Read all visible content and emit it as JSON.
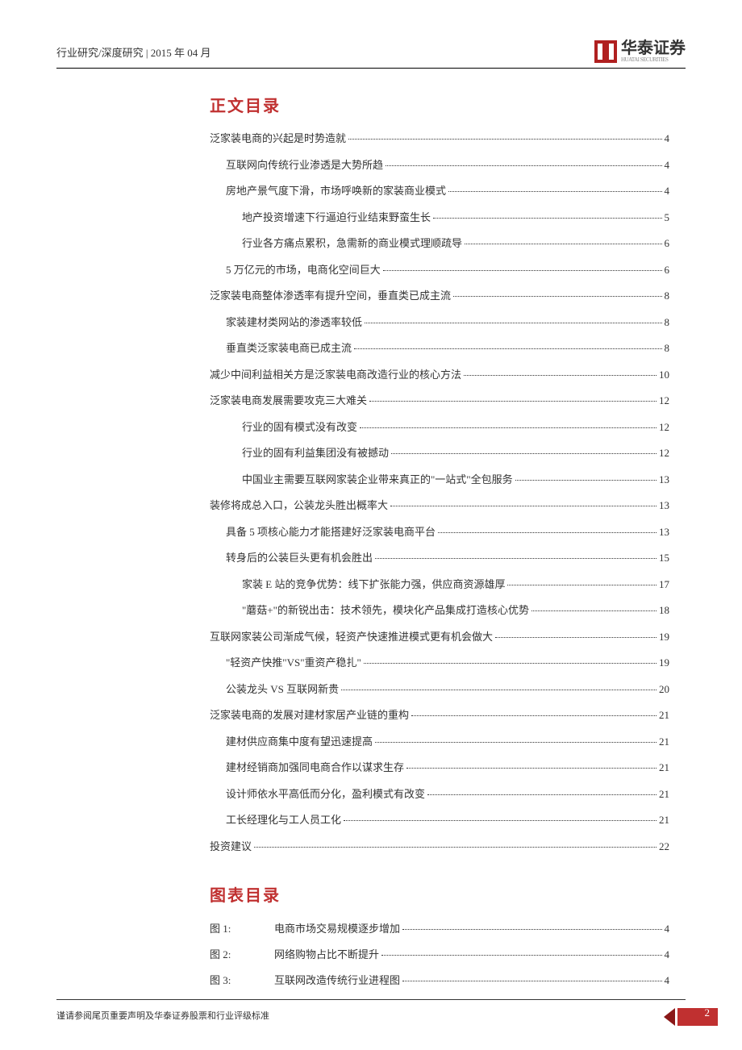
{
  "header": {
    "breadcrumb": "行业研究/深度研究 | 2015 年 04 月",
    "logo_name": "华泰证券",
    "logo_sub": "HUATAI SECURITIES"
  },
  "sections": {
    "toc_title": "正文目录",
    "fig_title": "图表目录"
  },
  "toc": [
    {
      "level": 1,
      "text": "泛家装电商的兴起是时势造就",
      "page": "4"
    },
    {
      "level": 2,
      "text": "互联网向传统行业渗透是大势所趋",
      "page": "4"
    },
    {
      "level": 2,
      "text": "房地产景气度下滑，市场呼唤新的家装商业模式",
      "page": "4"
    },
    {
      "level": 3,
      "text": "地产投资增速下行逼迫行业结束野蛮生长",
      "page": "5"
    },
    {
      "level": 3,
      "text": "行业各方痛点累积，急需新的商业模式理顺疏导",
      "page": "6"
    },
    {
      "level": 2,
      "text": "5 万亿元的市场，电商化空间巨大",
      "page": "6"
    },
    {
      "level": 1,
      "text": "泛家装电商整体渗透率有提升空间，垂直类已成主流",
      "page": "8"
    },
    {
      "level": 2,
      "text": "家装建材类网站的渗透率较低",
      "page": "8"
    },
    {
      "level": 2,
      "text": "垂直类泛家装电商已成主流",
      "page": "8"
    },
    {
      "level": 1,
      "text": "减少中间利益相关方是泛家装电商改造行业的核心方法",
      "page": "10"
    },
    {
      "level": 1,
      "text": "泛家装电商发展需要攻克三大难关",
      "page": "12"
    },
    {
      "level": 3,
      "text": "行业的固有模式没有改变",
      "page": "12"
    },
    {
      "level": 3,
      "text": "行业的固有利益集团没有被撼动",
      "page": "12"
    },
    {
      "level": 3,
      "text": "中国业主需要互联网家装企业带来真正的\"一站式\"全包服务",
      "page": "13"
    },
    {
      "level": 1,
      "text": "装修将成总入口，公装龙头胜出概率大",
      "page": "13"
    },
    {
      "level": 2,
      "text": "具备 5 项核心能力才能搭建好泛家装电商平台",
      "page": "13"
    },
    {
      "level": 2,
      "text": "转身后的公装巨头更有机会胜出",
      "page": "15"
    },
    {
      "level": 3,
      "text": "家装 E 站的竞争优势：线下扩张能力强，供应商资源雄厚",
      "page": "17"
    },
    {
      "level": 3,
      "text": "\"蘑菇+\"的新锐出击：技术领先，模块化产品集成打造核心优势",
      "page": "18"
    },
    {
      "level": 1,
      "text": "互联网家装公司渐成气候，轻资产快速推进模式更有机会做大",
      "page": "19"
    },
    {
      "level": 2,
      "text": "\"轻资产快推\"VS\"重资产稳扎\"",
      "page": "19"
    },
    {
      "level": 2,
      "text": "公装龙头 VS 互联网新贵",
      "page": "20"
    },
    {
      "level": 1,
      "text": "泛家装电商的发展对建材家居产业链的重构",
      "page": "21"
    },
    {
      "level": 2,
      "text": "建材供应商集中度有望迅速提高",
      "page": "21"
    },
    {
      "level": 2,
      "text": "建材经销商加强同电商合作以谋求生存",
      "page": "21"
    },
    {
      "level": 2,
      "text": "设计师依水平高低而分化，盈利模式有改变",
      "page": "21"
    },
    {
      "level": 2,
      "text": "工长经理化与工人员工化",
      "page": "21"
    },
    {
      "level": 1,
      "text": "投资建议",
      "page": "22"
    }
  ],
  "figures": [
    {
      "label": "图 1:",
      "text": "电商市场交易规模逐步增加",
      "page": "4"
    },
    {
      "label": "图 2:",
      "text": "网络购物占比不断提升",
      "page": "4"
    },
    {
      "label": "图 3:",
      "text": "互联网改造传统行业进程图",
      "page": "4"
    }
  ],
  "footer": {
    "disclaimer": "谨请参阅尾页重要声明及华泰证券股票和行业评级标准",
    "page_number": "2"
  }
}
